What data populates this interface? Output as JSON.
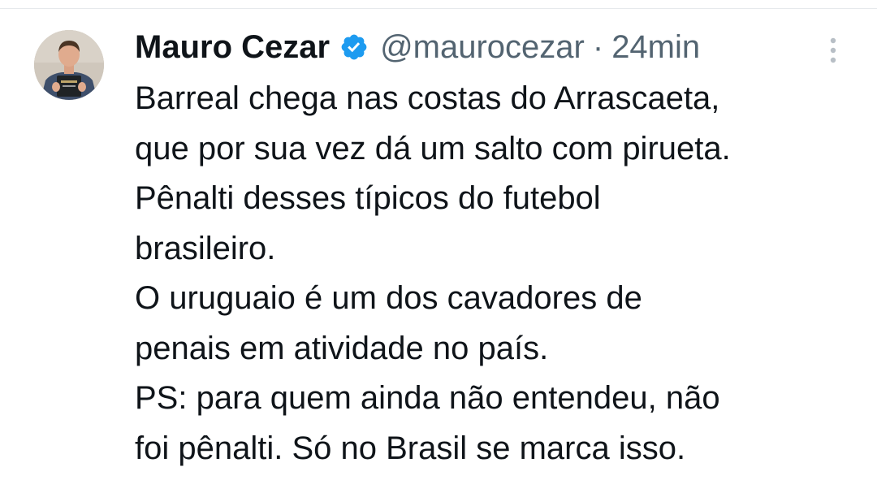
{
  "tweet": {
    "author": {
      "display_name": "Mauro Cezar",
      "handle": "@maurocezar",
      "verified_icon": "verified-badge-icon",
      "avatar_icon": "avatar-photo"
    },
    "separator": "·",
    "timestamp": "24min",
    "more_icon": "more-vertical-icon",
    "text_lines": [
      "Barreal chega nas costas do Arrascaeta,",
      "que por sua vez dá um salto com pirueta.",
      "Pênalti desses típicos do futebol",
      "brasileiro.",
      "O uruguaio é um dos cavadores de",
      "penais em atividade no país.",
      "PS: para quem ainda não entendeu, não",
      "foi pênalti. Só no Brasil se marca isso."
    ]
  },
  "colors": {
    "text": "#0f1419",
    "secondary_text": "#536471",
    "verified_blue": "#1d9bf0",
    "divider": "#e6e9ec"
  }
}
